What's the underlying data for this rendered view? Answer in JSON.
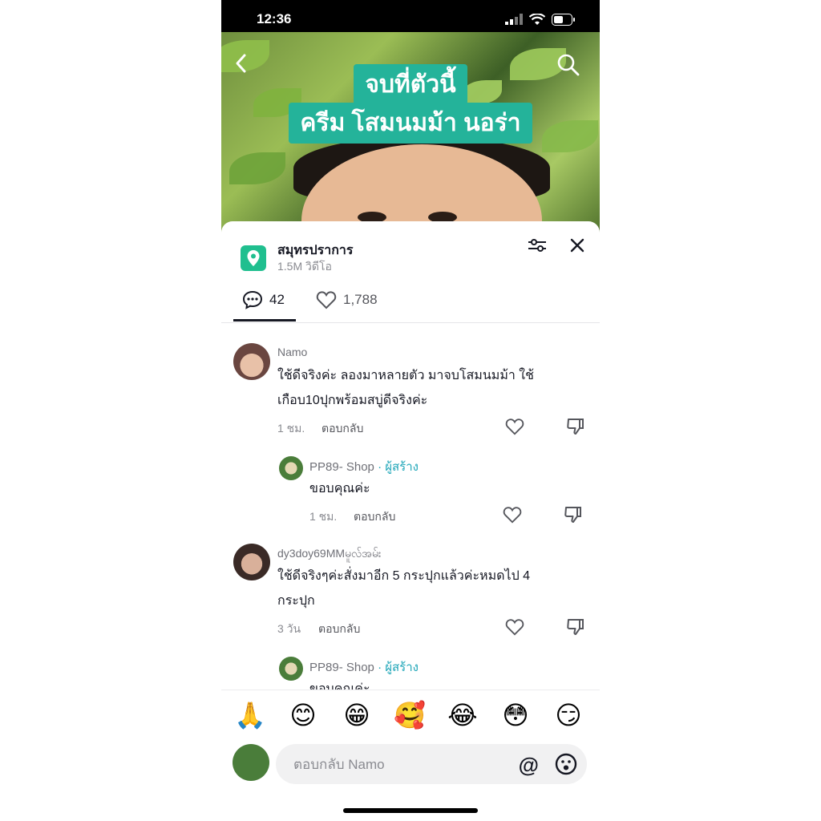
{
  "status": {
    "time": "12:36"
  },
  "video": {
    "caption_line1": "จบที่ตัวนี้",
    "caption_line2": "ครีม โสมนมม้า นอร่า",
    "icons": {
      "back": "chevron-left-icon",
      "search": "search-icon"
    }
  },
  "sheet": {
    "location_icon": "location-pin-icon",
    "title": "สมุทรปราการ",
    "subtitle": "1.5M วิดีโอ",
    "filter_icon": "filter-icon",
    "close_icon": "close-icon",
    "comments_count": "42",
    "likes_count": "1,788"
  },
  "comments": [
    {
      "user": "Namo",
      "line1": "ใช้ดีจริงค่ะ ลองมาหลายตัว มาจบโสมนมม้า ใช้",
      "line2": "เกือบ10ปุกพร้อมสบู่ดีจริงค่ะ",
      "time": "1 ชม.",
      "reply": "ตอบกลับ",
      "sub": {
        "user": "PP89- Shop",
        "badge": "· ผู้สร้าง",
        "text": "ขอบคุณค่ะ",
        "time": "1 ชม.",
        "reply": "ตอบกลับ"
      }
    },
    {
      "user": "dy3doy69MMမူလ်အမ်း",
      "line1": "ใช้ดีจริงๆค่ะสั่งมาอีก 5 กระปุกแล้วค่ะหมดไป 4",
      "line2": "กระปุก",
      "time": "3 วัน",
      "reply": "ตอบกลับ",
      "sub": {
        "user": "PP89- Shop",
        "badge": "· ผู้สร้าง",
        "text": "ขอบคุณค่ะ"
      }
    }
  ],
  "emojis": [
    "🙏",
    "😊",
    "😁",
    "🥰",
    "😂",
    "😳",
    "😏"
  ],
  "input": {
    "placeholder": "ตอบกลับ Namo",
    "at": "@"
  },
  "colors": {
    "accent": "#24b39a",
    "creator": "#1fa6b8",
    "location": "#20bf8f"
  }
}
